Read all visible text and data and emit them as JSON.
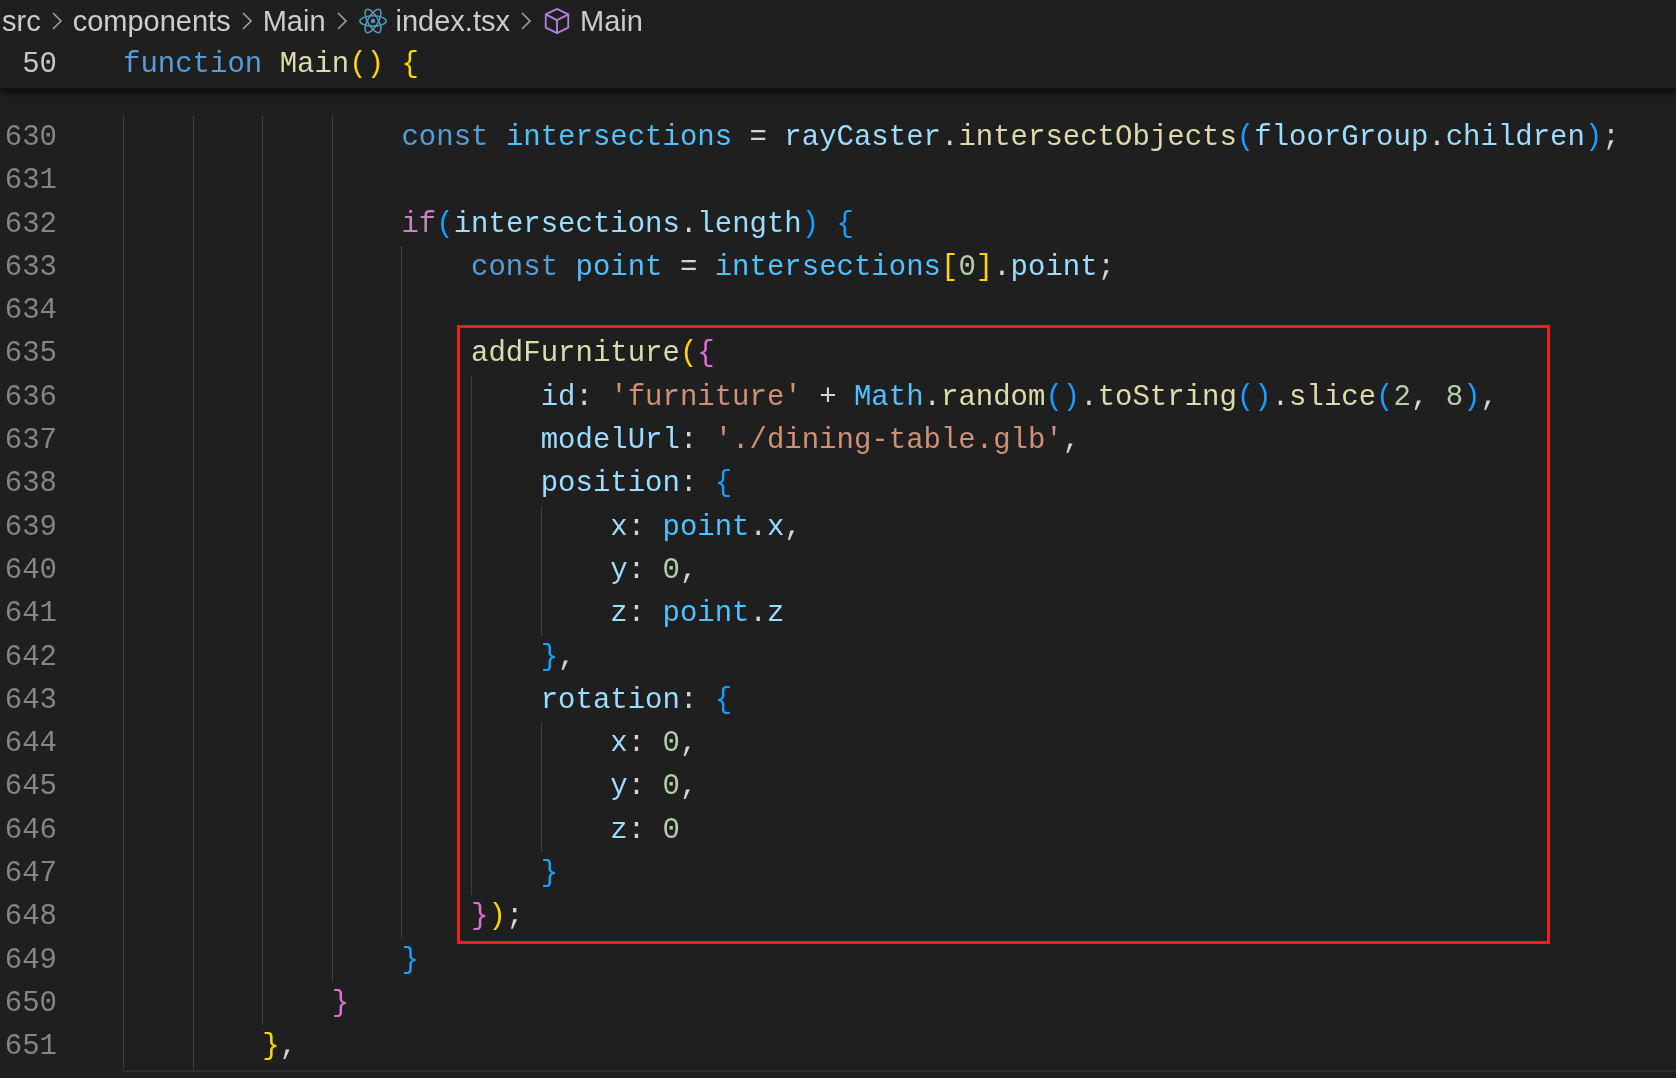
{
  "breadcrumb": [
    {
      "label": "src",
      "kind": "folder"
    },
    {
      "label": "components",
      "kind": "folder"
    },
    {
      "label": "Main",
      "kind": "folder"
    },
    {
      "label": "index.tsx",
      "kind": "react-file"
    },
    {
      "label": "Main",
      "kind": "component"
    }
  ],
  "sticky_line": {
    "number": "50",
    "tokens": [
      {
        "text": "function ",
        "kind": "kw"
      },
      {
        "text": "Main",
        "kind": "fn"
      },
      {
        "text": "()",
        "kind": "b1"
      },
      {
        "text": " {",
        "kind": "b1"
      }
    ]
  },
  "lines": [
    {
      "number": "630",
      "boxed": false,
      "tokens": [
        {
          "text": "                const ",
          "kind": "kw"
        },
        {
          "text": "intersections",
          "kind": "const"
        },
        {
          "text": " = ",
          "kind": "punc"
        },
        {
          "text": "rayCaster",
          "kind": "var"
        },
        {
          "text": ".",
          "kind": "punc"
        },
        {
          "text": "intersectObjects",
          "kind": "fn"
        },
        {
          "text": "(",
          "kind": "b3"
        },
        {
          "text": "floorGroup",
          "kind": "var"
        },
        {
          "text": ".",
          "kind": "punc"
        },
        {
          "text": "children",
          "kind": "var"
        },
        {
          "text": ")",
          "kind": "b3"
        },
        {
          "text": ";",
          "kind": "punc"
        }
      ]
    },
    {
      "number": "631",
      "boxed": false
    },
    {
      "number": "632",
      "boxed": false,
      "tokens": [
        {
          "text": "                if",
          "kind": "ctrl"
        },
        {
          "text": "(",
          "kind": "b3"
        },
        {
          "text": "intersections",
          "kind": "var"
        },
        {
          "text": ".",
          "kind": "punc"
        },
        {
          "text": "length",
          "kind": "var"
        },
        {
          "text": ")",
          "kind": "b3"
        },
        {
          "text": " {",
          "kind": "b3"
        }
      ]
    },
    {
      "number": "633",
      "boxed": false,
      "tokens": [
        {
          "text": "                    const ",
          "kind": "kw"
        },
        {
          "text": "point",
          "kind": "const"
        },
        {
          "text": " = ",
          "kind": "punc"
        },
        {
          "text": "intersections",
          "kind": "const"
        },
        {
          "text": "[",
          "kind": "b1"
        },
        {
          "text": "0",
          "kind": "num"
        },
        {
          "text": "]",
          "kind": "b1"
        },
        {
          "text": ".",
          "kind": "punc"
        },
        {
          "text": "point",
          "kind": "var"
        },
        {
          "text": ";",
          "kind": "punc"
        }
      ]
    },
    {
      "number": "634",
      "boxed": false
    },
    {
      "number": "635",
      "boxed": true,
      "tokens": [
        {
          "text": "                    addFurniture",
          "kind": "fn"
        },
        {
          "text": "(",
          "kind": "b1"
        },
        {
          "text": "{",
          "kind": "b2"
        }
      ]
    },
    {
      "number": "636",
      "boxed": true,
      "tokens": [
        {
          "text": "                        id",
          "kind": "var"
        },
        {
          "text": ": ",
          "kind": "punc"
        },
        {
          "text": "'furniture'",
          "kind": "str"
        },
        {
          "text": " + ",
          "kind": "punc"
        },
        {
          "text": "Math",
          "kind": "const"
        },
        {
          "text": ".",
          "kind": "punc"
        },
        {
          "text": "random",
          "kind": "fn"
        },
        {
          "text": "()",
          "kind": "b3"
        },
        {
          "text": ".",
          "kind": "punc"
        },
        {
          "text": "toString",
          "kind": "fn"
        },
        {
          "text": "()",
          "kind": "b3"
        },
        {
          "text": ".",
          "kind": "punc"
        },
        {
          "text": "slice",
          "kind": "fn"
        },
        {
          "text": "(",
          "kind": "b3"
        },
        {
          "text": "2",
          "kind": "num"
        },
        {
          "text": ", ",
          "kind": "punc"
        },
        {
          "text": "8",
          "kind": "num"
        },
        {
          "text": ")",
          "kind": "b3"
        },
        {
          "text": ",",
          "kind": "punc"
        }
      ]
    },
    {
      "number": "637",
      "boxed": true,
      "tokens": [
        {
          "text": "                        modelUrl",
          "kind": "var"
        },
        {
          "text": ": ",
          "kind": "punc"
        },
        {
          "text": "'./dining-table.glb'",
          "kind": "str"
        },
        {
          "text": ",",
          "kind": "punc"
        }
      ]
    },
    {
      "number": "638",
      "boxed": true,
      "tokens": [
        {
          "text": "                        position",
          "kind": "var"
        },
        {
          "text": ": ",
          "kind": "punc"
        },
        {
          "text": "{",
          "kind": "b3"
        }
      ]
    },
    {
      "number": "639",
      "boxed": true,
      "tokens": [
        {
          "text": "                            x",
          "kind": "var"
        },
        {
          "text": ": ",
          "kind": "punc"
        },
        {
          "text": "point",
          "kind": "const"
        },
        {
          "text": ".",
          "kind": "punc"
        },
        {
          "text": "x",
          "kind": "var"
        },
        {
          "text": ",",
          "kind": "punc"
        }
      ]
    },
    {
      "number": "640",
      "boxed": true,
      "tokens": [
        {
          "text": "                            y",
          "kind": "var"
        },
        {
          "text": ": ",
          "kind": "punc"
        },
        {
          "text": "0",
          "kind": "num"
        },
        {
          "text": ",",
          "kind": "punc"
        }
      ]
    },
    {
      "number": "641",
      "boxed": true,
      "tokens": [
        {
          "text": "                            z",
          "kind": "var"
        },
        {
          "text": ": ",
          "kind": "punc"
        },
        {
          "text": "point",
          "kind": "const"
        },
        {
          "text": ".",
          "kind": "punc"
        },
        {
          "text": "z",
          "kind": "var"
        }
      ]
    },
    {
      "number": "642",
      "boxed": true,
      "tokens": [
        {
          "text": "                        }",
          "kind": "b3"
        },
        {
          "text": ",",
          "kind": "punc"
        }
      ]
    },
    {
      "number": "643",
      "boxed": true,
      "tokens": [
        {
          "text": "                        rotation",
          "kind": "var"
        },
        {
          "text": ": ",
          "kind": "punc"
        },
        {
          "text": "{",
          "kind": "b3"
        }
      ]
    },
    {
      "number": "644",
      "boxed": true,
      "tokens": [
        {
          "text": "                            x",
          "kind": "var"
        },
        {
          "text": ": ",
          "kind": "punc"
        },
        {
          "text": "0",
          "kind": "num"
        },
        {
          "text": ",",
          "kind": "punc"
        }
      ]
    },
    {
      "number": "645",
      "boxed": true,
      "tokens": [
        {
          "text": "                            y",
          "kind": "var"
        },
        {
          "text": ": ",
          "kind": "punc"
        },
        {
          "text": "0",
          "kind": "num"
        },
        {
          "text": ",",
          "kind": "punc"
        }
      ]
    },
    {
      "number": "646",
      "boxed": true,
      "tokens": [
        {
          "text": "                            z",
          "kind": "var"
        },
        {
          "text": ": ",
          "kind": "punc"
        },
        {
          "text": "0",
          "kind": "num"
        }
      ]
    },
    {
      "number": "647",
      "boxed": true,
      "tokens": [
        {
          "text": "                        }",
          "kind": "b3"
        }
      ]
    },
    {
      "number": "648",
      "boxed": true,
      "tokens": [
        {
          "text": "                    }",
          "kind": "b2"
        },
        {
          "text": ")",
          "kind": "b1"
        },
        {
          "text": ";",
          "kind": "punc"
        }
      ]
    },
    {
      "number": "649",
      "boxed": false,
      "tokens": [
        {
          "text": "                }",
          "kind": "b3"
        }
      ]
    },
    {
      "number": "650",
      "boxed": false,
      "tokens": [
        {
          "text": "            }",
          "kind": "b2"
        }
      ]
    },
    {
      "number": "651",
      "boxed": false,
      "tokens": [
        {
          "text": "        }",
          "kind": "b1"
        },
        {
          "text": ",",
          "kind": "punc"
        }
      ]
    }
  ]
}
